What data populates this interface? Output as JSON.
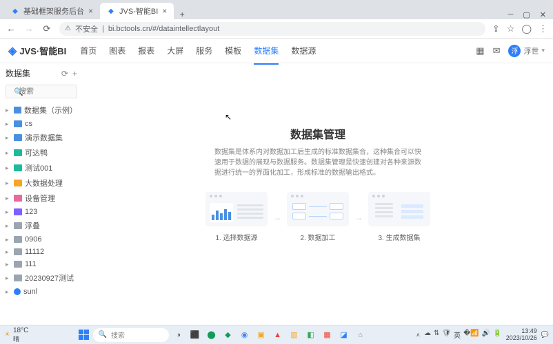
{
  "browser": {
    "tabs": [
      {
        "title": "基础框架服务后台"
      },
      {
        "title": "JVS-智能BI"
      }
    ],
    "insecure_label": "不安全",
    "url": "bi.bctools.cn/#/dataintellectlayout"
  },
  "header": {
    "logo": "JVS·智能BI",
    "nav": [
      "首页",
      "图表",
      "报表",
      "大屏",
      "服务",
      "模板",
      "数据集",
      "数据源"
    ],
    "nav_active_index": 6,
    "user": "浮世"
  },
  "sidebar": {
    "title": "数据集",
    "search_placeholder": "搜索",
    "items": [
      {
        "label": "数据集（示例）",
        "color": "fi-blue"
      },
      {
        "label": "cs",
        "color": "fi-blue"
      },
      {
        "label": "演示数据集",
        "color": "fi-blue"
      },
      {
        "label": "可达鸭",
        "color": "fi-teal"
      },
      {
        "label": "测试001",
        "color": "fi-teal"
      },
      {
        "label": "大数据处理",
        "color": "fi-orange"
      },
      {
        "label": "设备管理",
        "color": "fi-pink"
      },
      {
        "label": "123",
        "color": "fi-purple"
      },
      {
        "label": "浮叠",
        "color": "fi-gray"
      },
      {
        "label": "0906",
        "color": "fi-gray"
      },
      {
        "label": "11112",
        "color": "fi-gray"
      },
      {
        "label": "111",
        "color": "fi-gray"
      },
      {
        "label": "20230927测试",
        "color": "fi-gray"
      },
      {
        "label": "sunl",
        "color": "user"
      }
    ]
  },
  "main": {
    "title": "数据集管理",
    "desc": "数据集是体系内对数据加工后生成的标准数据集合，这种集合可以快速用于数据的展现与数据服务。数据集管理是快速创建对各种来源数据进行统一的界面化加工，形成标准的数据输出格式。",
    "steps": [
      "1. 选择数据源",
      "2. 数据加工",
      "3. 生成数据集"
    ]
  },
  "taskbar": {
    "weather_temp": "18°C",
    "weather_label": "晴",
    "search_placeholder": "搜索",
    "time": "13:49",
    "date": "2023/10/26"
  }
}
